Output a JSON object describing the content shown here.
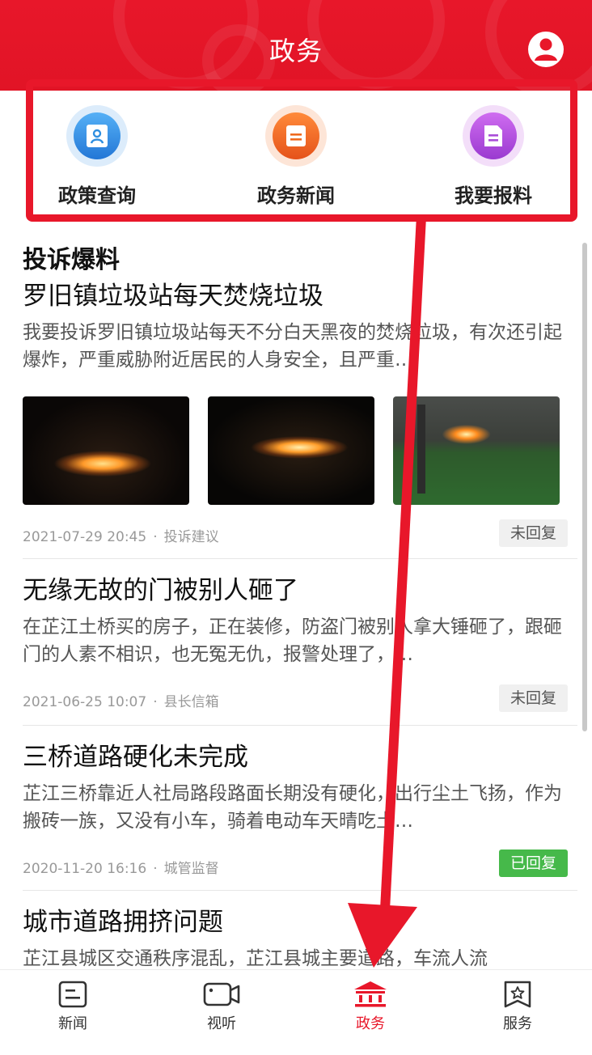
{
  "header": {
    "title": "政务",
    "user_icon": "user-icon",
    "accent": "#e8172a"
  },
  "quick_menu": [
    {
      "label": "政策查询",
      "icon": "policy-search-icon",
      "color": "#2f8fe0"
    },
    {
      "label": "政务新闻",
      "icon": "gov-news-icon",
      "color": "#ef6a1f"
    },
    {
      "label": "我要报料",
      "icon": "report-icon",
      "color": "#a94ed8"
    }
  ],
  "section_title": "投诉爆料",
  "posts": [
    {
      "title": "罗旧镇垃圾站每天焚烧垃圾",
      "body": "我要投诉罗旧镇垃圾站每天不分白天黑夜的焚烧垃圾，有次还引起爆炸，严重威胁附近居民的人身安全，且严重…",
      "time": "2021-07-29 20:45",
      "category": "投诉建议",
      "status": "未回复"
    },
    {
      "title": "无缘无故的门被别人砸了",
      "body": "在芷江土桥买的房子，正在装修，防盗门被别人拿大锤砸了，跟砸门的人素不相识，也无冤无仇，报警处理了，…",
      "time": "2021-06-25 10:07",
      "category": "县长信箱",
      "status": "未回复"
    },
    {
      "title": "三桥道路硬化未完成",
      "body": "芷江三桥靠近人社局路段路面长期没有硬化，出行尘土飞扬，作为搬砖一族，又没有小车，骑着电动车天晴吃土…",
      "time": "2020-11-20 16:16",
      "category": "城管监督",
      "status": "已回复"
    },
    {
      "title": "城市道路拥挤问题",
      "body": "芷江县城区交通秩序混乱，芷江县城主要道路，车流人流"
    }
  ],
  "bottom_nav": [
    {
      "label": "新闻",
      "icon": "news-icon"
    },
    {
      "label": "视听",
      "icon": "video-icon"
    },
    {
      "label": "政务",
      "icon": "government-icon",
      "active": true
    },
    {
      "label": "服务",
      "icon": "service-icon"
    }
  ],
  "status_colors": {
    "pending_bg": "#f0f0f0",
    "done_bg": "#46b94a"
  }
}
